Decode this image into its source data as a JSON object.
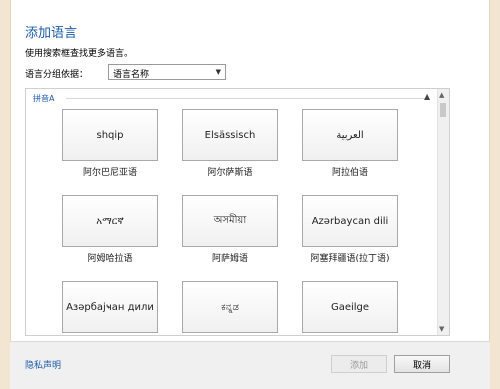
{
  "dialog": {
    "title": "添加语言",
    "description": "使用搜索框查找更多语言。",
    "group_label": "语言分组依据：",
    "group_select_value": "语言名称"
  },
  "section": {
    "header": "拼音A"
  },
  "languages": [
    {
      "native": "shqip",
      "caption": "阿尔巴尼亚语"
    },
    {
      "native": "Elsässisch",
      "caption": "阿尔萨斯语"
    },
    {
      "native": "العربية",
      "caption": "阿拉伯语"
    },
    {
      "native": "አማርኛ",
      "caption": "阿姆哈拉语"
    },
    {
      "native": "অসমীয়া",
      "caption": "阿萨姆语"
    },
    {
      "native": "Azərbaycan dili",
      "caption": "阿塞拜疆语(拉丁语)"
    },
    {
      "native": "Азәрбајҹан дили",
      "caption": ""
    },
    {
      "native": "ಕನ್ನಡ",
      "caption": ""
    },
    {
      "native": "Gaeilge",
      "caption": ""
    }
  ],
  "footer": {
    "privacy_link": "隐私声明",
    "add_button": "添加",
    "cancel_button": "取消"
  }
}
